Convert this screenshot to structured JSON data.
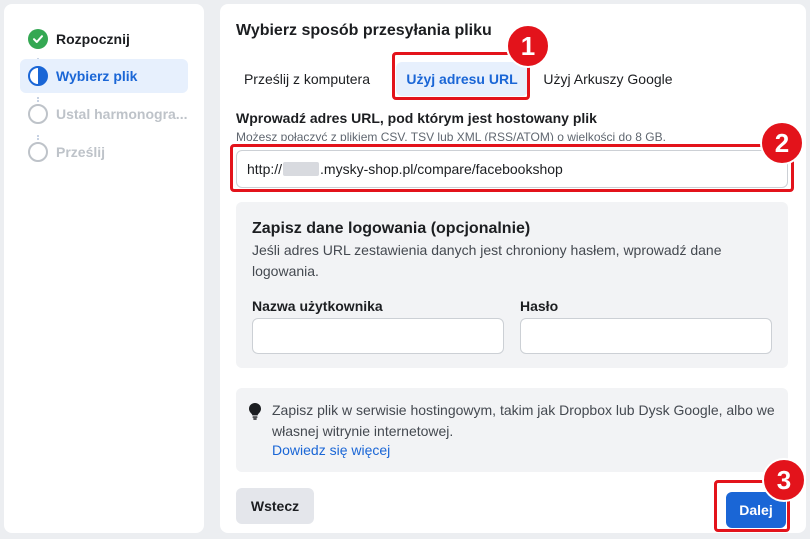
{
  "sidebar": {
    "steps": [
      {
        "label": "Rozpocznij",
        "state": "done"
      },
      {
        "label": "Wybierz plik",
        "state": "active"
      },
      {
        "label": "Ustal harmonogra...",
        "state": "pending"
      },
      {
        "label": "Prześlij",
        "state": "pending"
      }
    ]
  },
  "main": {
    "title": "Wybierz sposób przesyłania pliku",
    "tabs": [
      {
        "label": "Prześlij z komputera"
      },
      {
        "label": "Użyj adresu URL",
        "selected": true
      },
      {
        "label": "Użyj Arkuszy Google"
      }
    ],
    "url_label": "Wprowadź adres URL, pod którym jest hostowany plik",
    "url_hint": "Możesz połączyć z plikiem CSV, TSV lub XML (RSS/ATOM) o wielkości do 8 GB.",
    "url_prefix": "http://",
    "url_suffix": ".mysky-shop.pl/compare/facebookshop",
    "login": {
      "title": "Zapisz dane logowania (opcjonalnie)",
      "description": "Jeśli adres URL zestawienia danych jest chroniony hasłem, wprowadź dane logowania.",
      "username_label": "Nazwa użytkownika",
      "password_label": "Hasło"
    },
    "tip": {
      "icon": "lightbulb-icon",
      "text": "Zapisz plik w serwisie hostingowym, takim jak Dropbox lub Dysk Google, albo we własnej witrynie internetowej.",
      "link": "Dowiedz się więcej"
    },
    "back_label": "Wstecz",
    "next_label": "Dalej"
  },
  "annotations": [
    {
      "number": "1"
    },
    {
      "number": "2"
    },
    {
      "number": "3"
    }
  ],
  "colors": {
    "accent": "#1a66d6",
    "annotation_red": "#e3131b",
    "done_green": "#34a853"
  }
}
